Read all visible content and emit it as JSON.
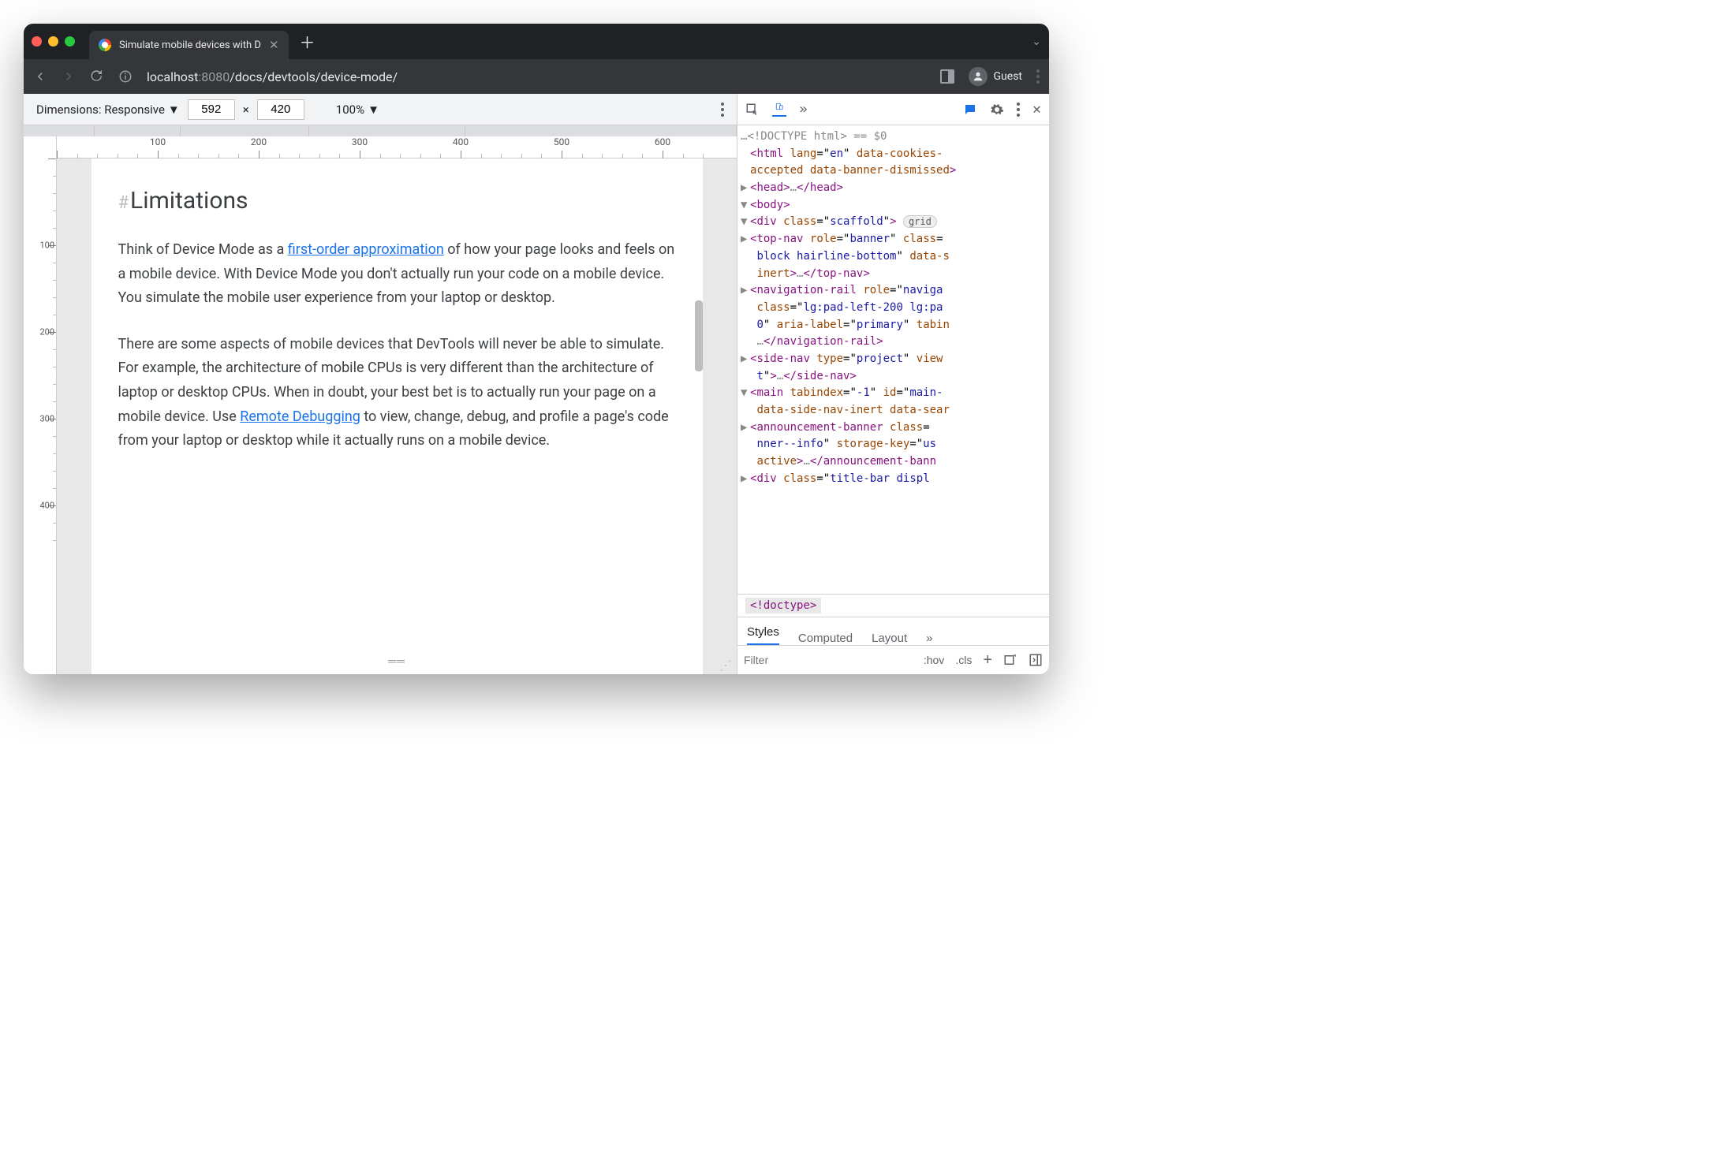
{
  "browser": {
    "tab_title": "Simulate mobile devices with D",
    "guest_label": "Guest",
    "url_host": "localhost",
    "url_port": ":8080",
    "url_path": "/docs/devtools/device-mode/"
  },
  "device_toolbar": {
    "dimensions_label": "Dimensions: Responsive",
    "width": "592",
    "separator": "×",
    "height": "420",
    "zoom": "100%"
  },
  "rulers": {
    "h_marks": [
      100,
      200,
      300,
      400,
      500,
      600
    ],
    "v_marks": [
      100,
      200,
      300,
      400
    ]
  },
  "doc": {
    "heading": "Limitations",
    "p1_a": "Think of Device Mode as a ",
    "p1_link": "first-order approximation",
    "p1_b": " of how your page looks and feels on a mobile device. With Device Mode you don't actually run your code on a mobile device. You simulate the mobile user experience from your laptop or desktop.",
    "p2_a": "There are some aspects of mobile devices that DevTools will never be able to simulate. For example, the architecture of mobile CPUs is very different than the architecture of laptop or desktop CPUs. When in doubt, your best bet is to actually run your page on a mobile device. Use ",
    "p2_link": "Remote Debugging",
    "p2_b": " to view, change, debug, and profile a page's code from your laptop or desktop while it actually runs on a mobile device."
  },
  "devtools": {
    "doctype": "<!DOCTYPE html>",
    "eq0": " == $0",
    "crumb": "<!doctype>",
    "styles_tabs": [
      "Styles",
      "Computed",
      "Layout"
    ],
    "filter_placeholder": "Filter",
    "hov": ":hov",
    "cls": ".cls"
  },
  "dom_lines": [
    {
      "indent": 0,
      "arrow": "",
      "html": "<span class='punc'>&lt;</span><span class='tag'>html</span> <span class='attr'>lang</span>=\"<span class='val'>en</span>\" <span class='attr'>data-cookies-</span>"
    },
    {
      "indent": 0,
      "arrow": "",
      "html": "<span class='attr'>accepted</span> <span class='attr'>data-banner-dismissed</span><span class='punc'>&gt;</span>"
    },
    {
      "indent": 1,
      "arrow": "▶",
      "html": "<span class='punc'>&lt;</span><span class='tag'>head</span><span class='punc'>&gt;</span><span class='gray'>…</span><span class='punc'>&lt;/</span><span class='tag'>head</span><span class='punc'>&gt;</span>"
    },
    {
      "indent": 1,
      "arrow": "▼",
      "html": "<span class='punc'>&lt;</span><span class='tag'>body</span><span class='punc'>&gt;</span>"
    },
    {
      "indent": 2,
      "arrow": "▼",
      "html": "<span class='punc'>&lt;</span><span class='tag'>div</span> <span class='attr'>class</span>=\"<span class='val'>scaffold</span>\"<span class='punc'>&gt;</span> <span class='pill'>grid</span>"
    },
    {
      "indent": 3,
      "arrow": "▶",
      "html": "<span class='punc'>&lt;</span><span class='tag'>top-nav</span> <span class='attr'>role</span>=\"<span class='val'>banner</span>\" <span class='attr'>class</span>="
    },
    {
      "indent": 3,
      "arrow": "",
      "html": "&nbsp;<span class='val'>block hairline-bottom</span>\" <span class='attr'>data-s</span>"
    },
    {
      "indent": 3,
      "arrow": "",
      "html": "&nbsp;<span class='attr'>inert</span><span class='punc'>&gt;</span><span class='gray'>…</span><span class='punc'>&lt;/</span><span class='tag'>top-nav</span><span class='punc'>&gt;</span>"
    },
    {
      "indent": 3,
      "arrow": "▶",
      "html": "<span class='punc'>&lt;</span><span class='tag'>navigation-rail</span> <span class='attr'>role</span>=\"<span class='val'>naviga</span>"
    },
    {
      "indent": 3,
      "arrow": "",
      "html": "&nbsp;<span class='attr'>class</span>=\"<span class='val'>lg:pad-left-200 lg:pa</span>"
    },
    {
      "indent": 3,
      "arrow": "",
      "html": "&nbsp;<span class='val'>0</span>\" <span class='attr'>aria-label</span>=\"<span class='val'>primary</span>\" <span class='attr'>tabin</span>"
    },
    {
      "indent": 3,
      "arrow": "",
      "html": "&nbsp;<span class='gray'>…</span><span class='punc'>&lt;/</span><span class='tag'>navigation-rail</span><span class='punc'>&gt;</span>"
    },
    {
      "indent": 3,
      "arrow": "▶",
      "html": "<span class='punc'>&lt;</span><span class='tag'>side-nav</span> <span class='attr'>type</span>=\"<span class='val'>project</span>\" <span class='attr'>view</span>"
    },
    {
      "indent": 3,
      "arrow": "",
      "html": "&nbsp;<span class='val'>t</span>\"<span class='punc'>&gt;</span><span class='gray'>…</span><span class='punc'>&lt;/</span><span class='tag'>side-nav</span><span class='punc'>&gt;</span>"
    },
    {
      "indent": 3,
      "arrow": "▼",
      "html": "<span class='punc'>&lt;</span><span class='tag'>main</span> <span class='attr'>tabindex</span>=\"<span class='val'>-1</span>\" <span class='attr'>id</span>=\"<span class='val'>main-</span>"
    },
    {
      "indent": 3,
      "arrow": "",
      "html": "&nbsp;<span class='attr'>data-side-nav-inert</span> <span class='attr'>data-sear</span>"
    },
    {
      "indent": 4,
      "arrow": "▶",
      "html": "<span class='punc'>&lt;</span><span class='tag'>announcement-banner</span> <span class='attr'>class</span>="
    },
    {
      "indent": 4,
      "arrow": "",
      "html": "&nbsp;<span class='val'>nner--info</span>\" <span class='attr'>storage-key</span>=\"<span class='val'>us</span>"
    },
    {
      "indent": 4,
      "arrow": "",
      "html": "&nbsp;<span class='attr'>active</span><span class='punc'>&gt;</span><span class='gray'>…</span><span class='punc'>&lt;/</span><span class='tag'>announcement-bann</span>"
    },
    {
      "indent": 4,
      "arrow": "▶",
      "html": "<span class='punc'>&lt;</span><span class='tag'>div</span> <span class='attr'>class</span>=\"<span class='val'>title-bar displ</span>"
    }
  ]
}
